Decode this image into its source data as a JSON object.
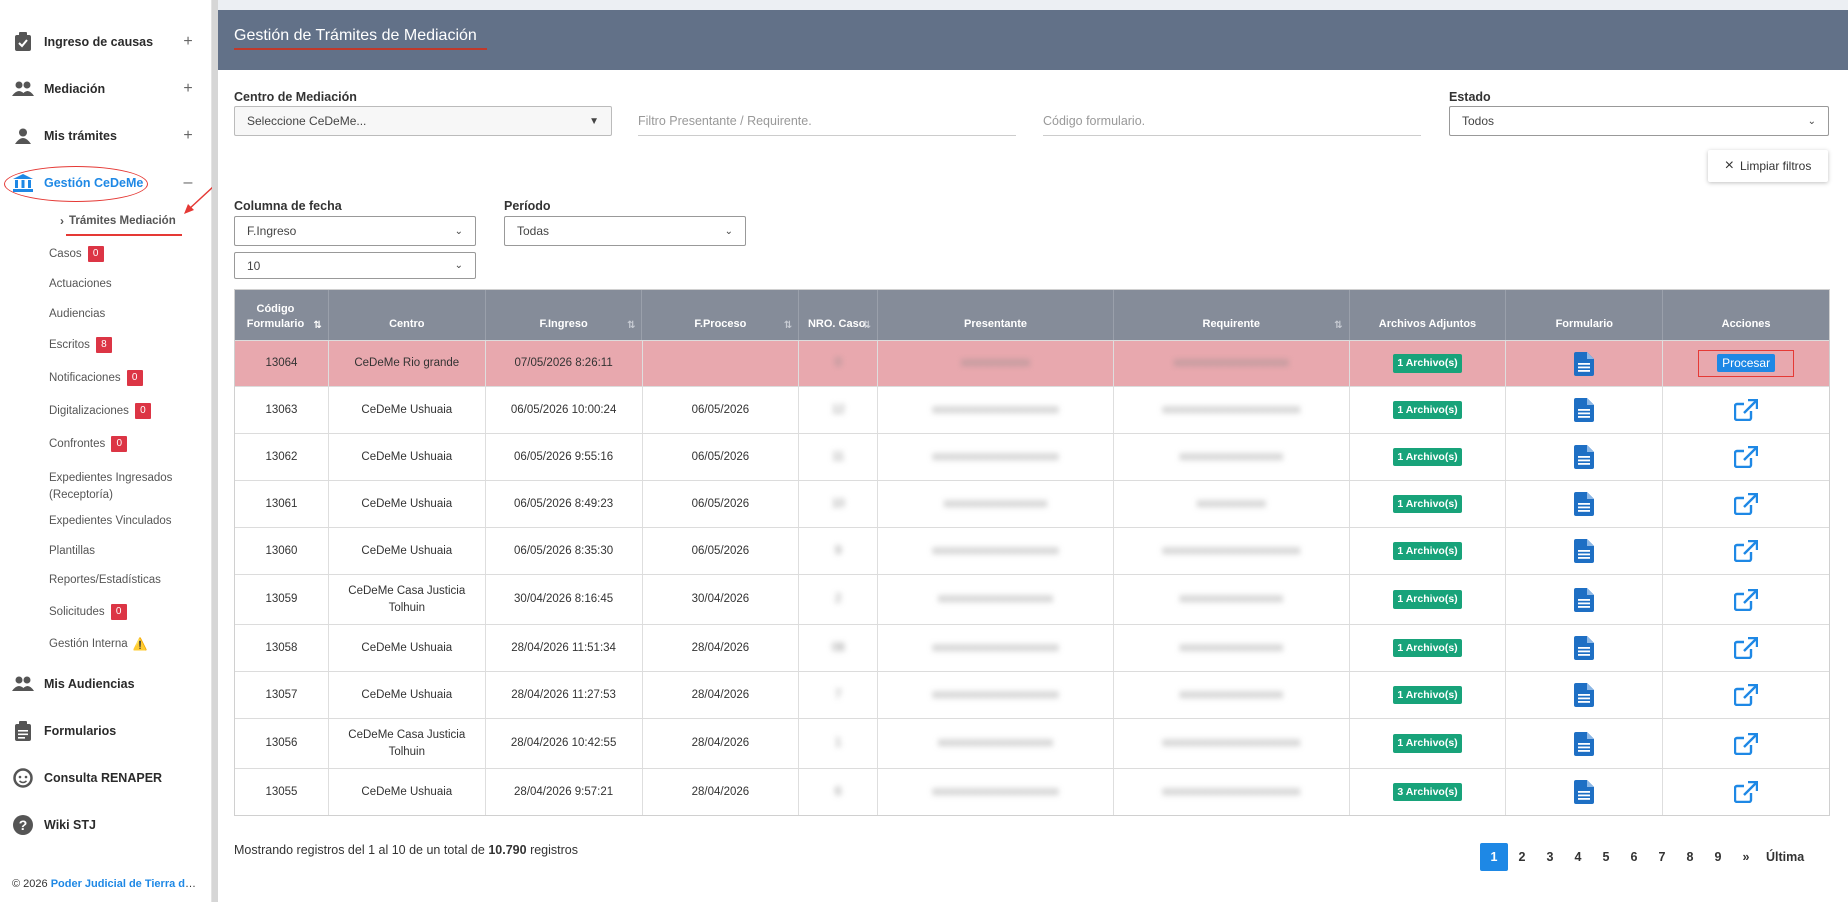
{
  "sidebar": {
    "items": [
      {
        "label": "Ingreso de causas",
        "icon": "clipboard-check-icon"
      },
      {
        "label": "Mediación",
        "icon": "users-icon"
      },
      {
        "label": "Mis trámites",
        "icon": "user-icon"
      },
      {
        "label": "Gestión CeDeMe",
        "icon": "bank-icon"
      }
    ],
    "active_sub": "Trámites Mediación",
    "sub_items": [
      {
        "label": "Casos",
        "badge": "0"
      },
      {
        "label": "Actuaciones"
      },
      {
        "label": "Audiencias"
      },
      {
        "label": "Escritos",
        "badge": "8"
      },
      {
        "label": "Notificaciones",
        "badge": "0"
      },
      {
        "label": "Digitalizaciones",
        "badge": "0"
      },
      {
        "label": "Confrontes",
        "badge": "0"
      },
      {
        "label": "Expedientes Ingresados",
        "label2": "(Receptoría)"
      },
      {
        "label": "Expedientes Vinculados"
      },
      {
        "label": "Plantillas"
      },
      {
        "label": "Reportes/Estadísticas"
      },
      {
        "label": "Solicitudes",
        "badge": "0"
      },
      {
        "label": "Gestión Interna",
        "warn": "⚠️"
      }
    ],
    "bottom_items": [
      {
        "label": "Mis Audiencias",
        "icon": "users-icon"
      },
      {
        "label": "Formularios",
        "icon": "clipboard-list-icon"
      },
      {
        "label": "Consulta RENAPER",
        "icon": "face-icon"
      },
      {
        "label": "Wiki STJ",
        "icon": "question-circle-icon"
      }
    ],
    "footer_prefix": "© 2026",
    "footer_link": "Poder Judicial de Tierra del Fuego"
  },
  "header": {
    "title": "Gestión de Trámites de Mediación"
  },
  "filters": {
    "centro_label": "Centro de Mediación",
    "centro_value": "Seleccione CeDeMe...",
    "presentante_placeholder": "Filtro Presentante / Requirente.",
    "codigo_placeholder": "Código formulario.",
    "estado_label": "Estado",
    "estado_value": "Todos",
    "clear_label": "Limpiar filtros",
    "columna_label": "Columna de fecha",
    "columna_value": "F.Ingreso",
    "page_size_value": "10",
    "periodo_label": "Período",
    "periodo_value": "Todas"
  },
  "table": {
    "headers": [
      "Código Formulario",
      "Centro",
      "F.Ingreso",
      "F.Proceso",
      "NRO. Caso.",
      "Presentante",
      "Requirente",
      "Archivos Adjuntos",
      "Formulario",
      "Acciones"
    ],
    "rows": [
      {
        "codigo": "13064",
        "centro": "CeDeMe Rio grande",
        "ingreso": "07/05/2026 8:26:11",
        "proceso": "",
        "caso": "0",
        "presentante": "xxxxxxxxxxxx",
        "requirente": "xxxxxxxxxxxxxxxxxxxx",
        "adjuntos": "1 Archivo(s)",
        "accion": "Procesar"
      },
      {
        "codigo": "13063",
        "centro": "CeDeMe Ushuaia",
        "ingreso": "06/05/2026 10:00:24",
        "proceso": "06/05/2026",
        "caso": "12",
        "presentante": "xxxxxxxxxxxxxxxxxxxxxx",
        "requirente": "xxxxxxxxxxxxxxxxxxxxxxxx",
        "adjuntos": "1 Archivo(s)",
        "accion": ""
      },
      {
        "codigo": "13062",
        "centro": "CeDeMe Ushuaia",
        "ingreso": "06/05/2026 9:55:16",
        "proceso": "06/05/2026",
        "caso": "11",
        "presentante": "xxxxxxxxxxxxxxxxxxxxxx",
        "requirente": "xxxxxxxxxxxxxxxxxx",
        "adjuntos": "1 Archivo(s)",
        "accion": ""
      },
      {
        "codigo": "13061",
        "centro": "CeDeMe Ushuaia",
        "ingreso": "06/05/2026 8:49:23",
        "proceso": "06/05/2026",
        "caso": "10",
        "presentante": "xxxxxxxxxxxxxxxxxx",
        "requirente": "xxxxxxxxxxxx",
        "adjuntos": "1 Archivo(s)",
        "accion": ""
      },
      {
        "codigo": "13060",
        "centro": "CeDeMe Ushuaia",
        "ingreso": "06/05/2026 8:35:30",
        "proceso": "06/05/2026",
        "caso": "9",
        "presentante": "xxxxxxxxxxxxxxxxxxxxxx",
        "requirente": "xxxxxxxxxxxxxxxxxxxxxxxx",
        "adjuntos": "1 Archivo(s)",
        "accion": ""
      },
      {
        "codigo": "13059",
        "centro": "CeDeMe Casa Justicia Tolhuin",
        "ingreso": "30/04/2026 8:16:45",
        "proceso": "30/04/2026",
        "caso": "2",
        "presentante": "xxxxxxxxxxxxxxxxxxxx",
        "requirente": "xxxxxxxxxxxxxxxxxx",
        "adjuntos": "1 Archivo(s)",
        "accion": ""
      },
      {
        "codigo": "13058",
        "centro": "CeDeMe Ushuaia",
        "ingreso": "28/04/2026 11:51:34",
        "proceso": "28/04/2026",
        "caso": "08",
        "presentante": "xxxxxxxxxxxxxxxxxxxxxx",
        "requirente": "xxxxxxxxxxxxxxxxxx",
        "adjuntos": "1 Archivo(s)",
        "accion": ""
      },
      {
        "codigo": "13057",
        "centro": "CeDeMe Ushuaia",
        "ingreso": "28/04/2026 11:27:53",
        "proceso": "28/04/2026",
        "caso": "7",
        "presentante": "xxxxxxxxxxxxxxxxxxxxxx",
        "requirente": "xxxxxxxxxxxxxxxxxx",
        "adjuntos": "1 Archivo(s)",
        "accion": ""
      },
      {
        "codigo": "13056",
        "centro": "CeDeMe Casa Justicia Tolhuin",
        "ingreso": "28/04/2026 10:42:55",
        "proceso": "28/04/2026",
        "caso": "1",
        "presentante": "xxxxxxxxxxxxxxxxxxxx",
        "requirente": "xxxxxxxxxxxxxxxxxxxxxxxx",
        "adjuntos": "1 Archivo(s)",
        "accion": ""
      },
      {
        "codigo": "13055",
        "centro": "CeDeMe Ushuaia",
        "ingreso": "28/04/2026 9:57:21",
        "proceso": "28/04/2026",
        "caso": "6",
        "presentante": "xxxxxxxxxxxxxxxxxxxxxx",
        "requirente": "xxxxxxxxxxxxxxxxxxxxxxxx",
        "adjuntos": "3 Archivo(s)",
        "accion": ""
      }
    ]
  },
  "summary": {
    "prefix": "Mostrando registros del 1 al 10 de un total de",
    "total": "10.790",
    "suffix": "registros"
  },
  "pagination": {
    "pages": [
      "1",
      "2",
      "3",
      "4",
      "5",
      "6",
      "7",
      "8",
      "9",
      "»",
      "Última"
    ],
    "active": "1"
  },
  "colors": {
    "header": "#627188",
    "table_head": "#858c99",
    "accent": "#1e88e5",
    "badge": "#dc3545",
    "attach": "#18a37a",
    "highlight_row": "#e8a8ae"
  }
}
